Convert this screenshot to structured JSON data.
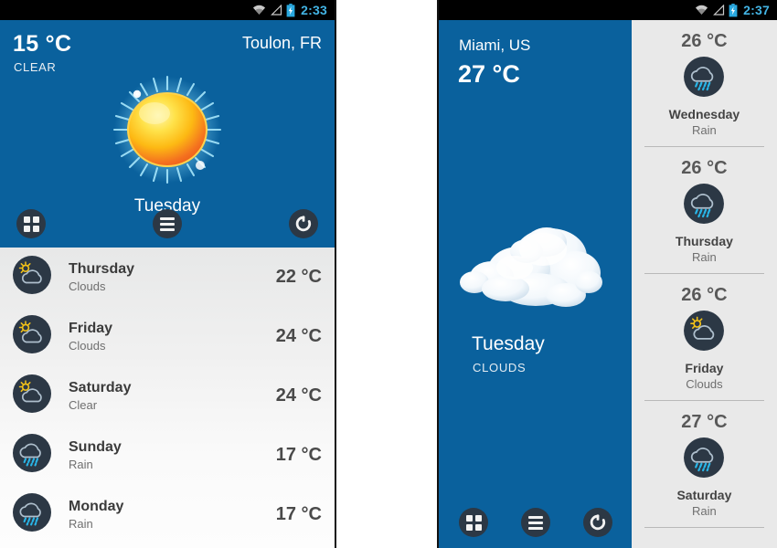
{
  "theme": {
    "brand_blue": "#0a619d",
    "status_bar_bg": "#000000",
    "status_time_color": "#43b4e4",
    "icon_circle": "#2c3845",
    "list_bg_top": "#e7e8e8",
    "list_bg_bottom": "#fdfdfd",
    "sidebar_bg": "#e9e9e9",
    "divider": "#b9b9b9",
    "sun_yellow": "#ffd200",
    "sun_orange": "#f36f21",
    "rain_drop": "#29b6e8",
    "cloud_outline": "#b7c7d4"
  },
  "phone_left": {
    "status_bar": {
      "time": "2:33",
      "icons": [
        "wifi-icon",
        "signal-icon",
        "battery-charging-icon"
      ]
    },
    "hero": {
      "temperature": "15 °C",
      "condition": "CLEAR",
      "location": "Toulon, FR",
      "day": "Tuesday",
      "weather_icon": "sun-icon"
    },
    "toolbar": {
      "buttons": [
        {
          "name": "grid-view-button",
          "icon": "grid-icon"
        },
        {
          "name": "list-view-button",
          "icon": "list-icon"
        },
        {
          "name": "refresh-button",
          "icon": "refresh-icon"
        }
      ]
    },
    "forecast": {
      "rows": [
        {
          "day": "Thursday",
          "condition": "Clouds",
          "temperature": "22 °C",
          "icon": "sun-cloud-icon"
        },
        {
          "day": "Friday",
          "condition": "Clouds",
          "temperature": "24 °C",
          "icon": "sun-cloud-icon"
        },
        {
          "day": "Saturday",
          "condition": "Clear",
          "temperature": "24 °C",
          "icon": "sun-cloud-icon"
        },
        {
          "day": "Sunday",
          "condition": "Rain",
          "temperature": "17 °C",
          "icon": "rain-cloud-icon"
        },
        {
          "day": "Monday",
          "condition": "Rain",
          "temperature": "17 °C",
          "icon": "rain-cloud-icon"
        }
      ]
    }
  },
  "phone_right": {
    "status_bar": {
      "time": "2:37",
      "icons": [
        "wifi-icon",
        "signal-icon",
        "battery-charging-icon"
      ]
    },
    "main": {
      "location": "Miami, US",
      "temperature": "27 °C",
      "day": "Tuesday",
      "condition": "CLOUDS",
      "weather_icon": "cloud-icon"
    },
    "toolbar": {
      "buttons": [
        {
          "name": "grid-view-button",
          "icon": "grid-icon"
        },
        {
          "name": "list-view-button",
          "icon": "list-icon"
        },
        {
          "name": "refresh-button",
          "icon": "refresh-icon"
        }
      ]
    },
    "forecast": {
      "cards": [
        {
          "temperature": "26 °C",
          "day": "Wednesday",
          "condition": "Rain",
          "icon": "rain-cloud-icon"
        },
        {
          "temperature": "26 °C",
          "day": "Thursday",
          "condition": "Rain",
          "icon": "rain-cloud-icon"
        },
        {
          "temperature": "26 °C",
          "day": "Friday",
          "condition": "Clouds",
          "icon": "sun-cloud-icon"
        },
        {
          "temperature": "27 °C",
          "day": "Saturday",
          "condition": "Rain",
          "icon": "rain-cloud-icon"
        }
      ]
    }
  }
}
